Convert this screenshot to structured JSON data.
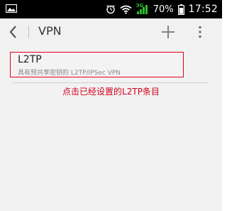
{
  "status_bar": {
    "battery_percent": "70%",
    "time": "17:52",
    "network_label": "3G",
    "icons": [
      "image-icon",
      "alarm-icon",
      "wifi-icon",
      "signal-icon",
      "battery-icon"
    ]
  },
  "action_bar": {
    "title": "VPN",
    "icons": [
      "back-icon",
      "add-icon",
      "more-icon"
    ]
  },
  "vpn_list": [
    {
      "name": "L2TP",
      "description": "具有预共享密钥的 L2TP/IPSec VPN"
    }
  ],
  "annotation": "点击已经设置的L2TP条目",
  "colors": {
    "status_bar_bg": "#000000",
    "highlight_border": "#e0001a",
    "annotation_text": "#d0021b"
  }
}
